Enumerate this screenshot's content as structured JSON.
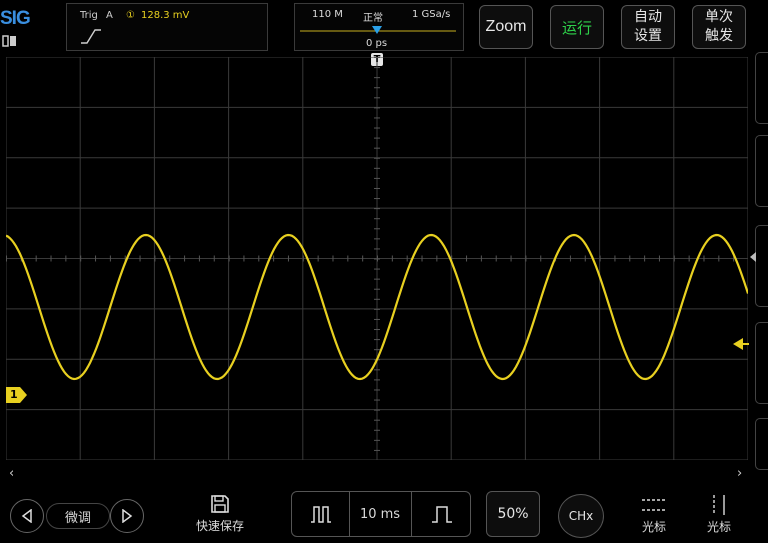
{
  "brand": {
    "logo_text": "SIG"
  },
  "trigger": {
    "label": "Trig",
    "source": "A",
    "channel_marker": "①",
    "level": "128.3 mV"
  },
  "timebase": {
    "memory_depth": "110 M",
    "acquire_mode": "正常",
    "sample_rate": "1 GSa/s",
    "offset": "0 ps",
    "trigger_pos_marker": "T"
  },
  "top_buttons": {
    "zoom": "Zoom",
    "run": "运行",
    "auto_line1": "自动",
    "auto_line2": "设置",
    "single_line1": "单次",
    "single_line2": "触发"
  },
  "waveform": {
    "channel_label": "1",
    "color": "#e8d020",
    "cycles_visible": 5.2
  },
  "bottom_bar": {
    "fine_label": "微调",
    "quick_save_label": "快速保存",
    "time_div": "10 ms",
    "fifty_percent": "50%",
    "chx": "CHx",
    "cursor_h_label": "光标",
    "cursor_v_label": "光标"
  },
  "colors": {
    "accent_blue": "#3a8fe0",
    "run_green": "#2ed24a",
    "channel1_yellow": "#e8d020"
  }
}
